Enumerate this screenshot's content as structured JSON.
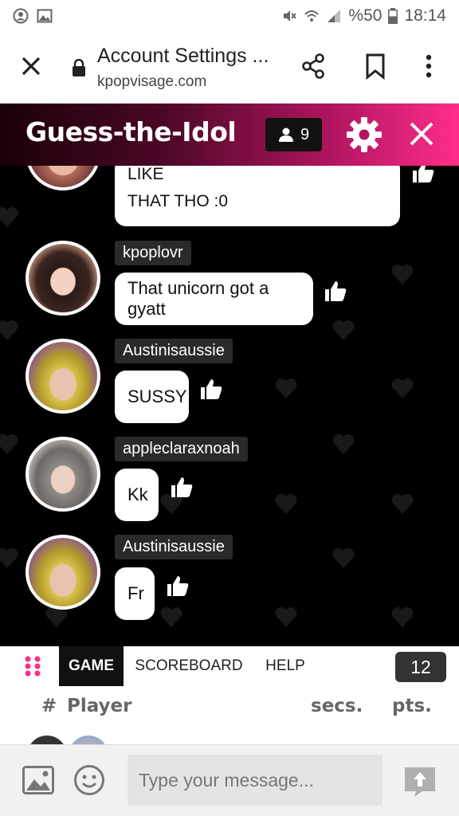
{
  "status_bar": {
    "battery": "%50",
    "time": "18:14"
  },
  "browser": {
    "title": "Account Settings ...",
    "url": "kpopvisage.com"
  },
  "game": {
    "title": "Guess-the-Idol",
    "player_count": "9"
  },
  "messages": [
    {
      "username": "",
      "lines": [
        "WHY IS HE TAGGING STUFF LIKE",
        "THAT THO :0"
      ]
    },
    {
      "username": "kpoplovr",
      "text": "That unicorn got a gyatt"
    },
    {
      "username": "Austinisaussie",
      "text": "SUSSY"
    },
    {
      "username": "appleclaraxnoah",
      "text": "Kk"
    },
    {
      "username": "Austinisaussie",
      "text": "Fr"
    }
  ],
  "tabs": [
    {
      "label": "GAME",
      "active": true
    },
    {
      "label": "SCOREBOARD",
      "active": false
    },
    {
      "label": "HELP",
      "active": false
    }
  ],
  "round_count": "12",
  "scoreboard": {
    "col_rank": "#",
    "col_player": "Player",
    "col_secs": "secs.",
    "col_pts": "pts."
  },
  "input": {
    "placeholder": "Type your message..."
  },
  "colors": {
    "accent": "#ff2d8a",
    "header_dark": "#1a0008",
    "bubble": "#ffffff",
    "chat_bg": "#000000"
  },
  "icons": [
    "account-circle-icon",
    "image-icon",
    "mute-icon",
    "wifi-icon",
    "signal-icon",
    "battery-icon",
    "close-icon",
    "lock-icon",
    "share-icon",
    "bookmark-icon",
    "more-vert-icon",
    "person-icon",
    "gear-icon",
    "heart-icon",
    "thumbs-up-icon",
    "grid-icon",
    "emoji-icon",
    "send-icon"
  ]
}
